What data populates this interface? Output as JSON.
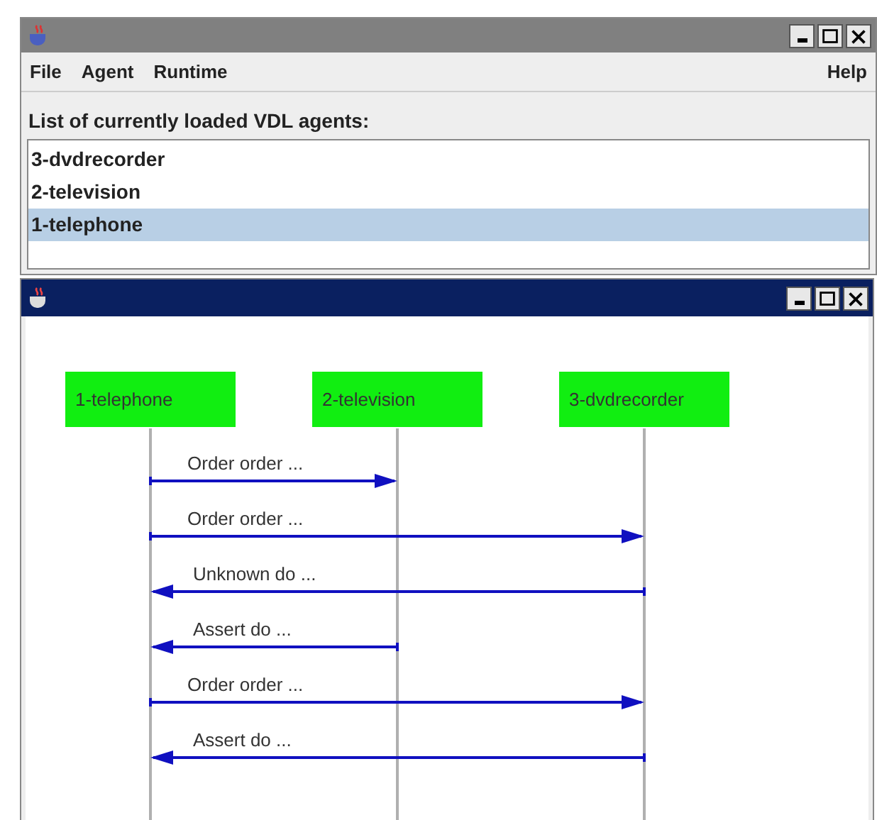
{
  "main_window": {
    "menu": [
      {
        "label": "File"
      },
      {
        "label": "Agent"
      },
      {
        "label": "Runtime"
      },
      {
        "label": "Help"
      }
    ],
    "list_label": "List of currently loaded VDL agents:",
    "agents": [
      {
        "label": "3-dvdrecorder",
        "selected": false
      },
      {
        "label": "2-television",
        "selected": false
      },
      {
        "label": "1-telephone",
        "selected": true
      }
    ]
  },
  "diagram_window": {
    "participants": [
      "1-telephone",
      "2-television",
      "3-dvdrecorder"
    ],
    "messages": [
      {
        "label": "Order order ...",
        "kind": "first_to_second"
      },
      {
        "label": "Order order ...",
        "kind": "first_to_third"
      },
      {
        "label": "Unknown do ...",
        "kind": "third_to_first"
      },
      {
        "label": "Assert do ...",
        "kind": "second_to_first"
      },
      {
        "label": "Order order ...",
        "kind": "first_to_third"
      },
      {
        "label": "Assert do ...",
        "kind": "third_to_first"
      }
    ]
  }
}
